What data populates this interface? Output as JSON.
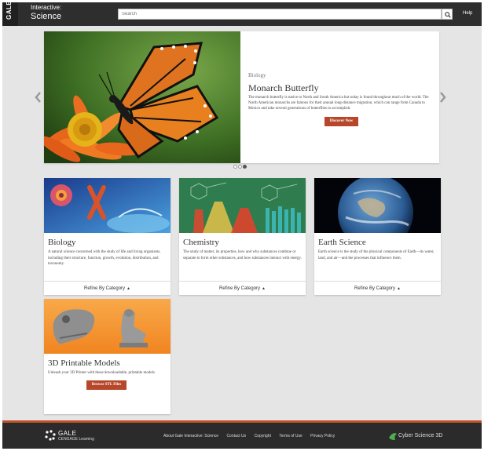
{
  "header": {
    "brand_vertical": "GALE",
    "title_line1": "Interactive:",
    "title_line2": "Science",
    "search_placeholder": "Search",
    "help": "Help"
  },
  "carousel": {
    "category": "Biology",
    "title": "Monarch Butterfly",
    "description": "The monarch butterfly is native to North and South America but today is found throughout much of the world. The North American monarchs are famous for their annual long-distance migration, which can range from Canada to Mexico and take several generations of butterflies to accomplish.",
    "button": "Discover Now",
    "slide_count": 3,
    "active_slide": 3
  },
  "cards": [
    {
      "title": "Biology",
      "description": "A natural science concerned with the study of life and living organisms, including their structure, function, growth, evolution, distribution, and taxonomy.",
      "footer": "Refine By Category"
    },
    {
      "title": "Chemistry",
      "description": "The study of matter, its properties, how and why substances combine or separate to form other substances, and how substances interact with energy.",
      "footer": "Refine By Category"
    },
    {
      "title": "Earth Science",
      "description": "Earth science is the study of the physical components of Earth—its water, land, and air—and the processes that influence them.",
      "footer": "Refine By Category"
    }
  ],
  "printable": {
    "title": "3D Printable Models",
    "description": "Unleash your 3D Printer with these downloadable, printable models",
    "button": "Browse STL Files"
  },
  "footer": {
    "logo_main": "GALE",
    "logo_sub": "CENGAGE Learning",
    "links": [
      "About Gale Interactive: Science",
      "Contact Us",
      "Copyright",
      "Terms of Use",
      "Privacy Policy"
    ],
    "partner": "Cyber Science 3D"
  },
  "colors": {
    "header_bg": "#2e2e2e",
    "accent_button": "#b7472a",
    "footer_bg": "#2b2b2b",
    "footer_stripe": "#c0502a"
  }
}
